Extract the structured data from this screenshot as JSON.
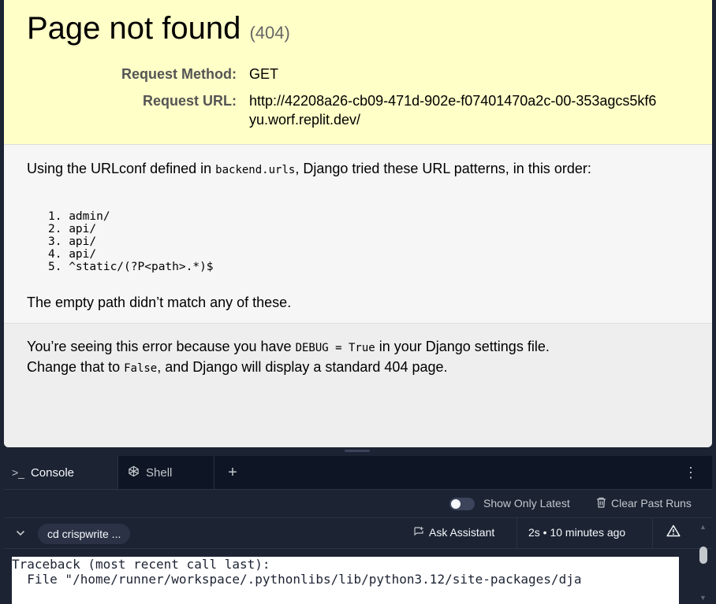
{
  "page": {
    "title": "Page not found",
    "status_code": "(404)",
    "request_method_label": "Request Method:",
    "request_method": "GET",
    "request_url_label": "Request URL:",
    "request_url": "http://42208a26-cb09-471d-902e-f07401470a2c-00-353agcs5kf6yu.worf.replit.dev/",
    "urlconf_intro_1": "Using the URLconf defined in ",
    "urlconf_module": "backend.urls",
    "urlconf_intro_2": ", Django tried these URL patterns, in this order:",
    "patterns": [
      "admin/",
      "api/",
      "api/",
      "api/",
      "^static/(?P<path>.*)$"
    ],
    "no_match": "The empty path didn’t match any of these.",
    "debug_1": "You’re seeing this error because you have ",
    "debug_code": "DEBUG = True",
    "debug_2": " in your Django settings file.",
    "debug_3": "Change that to ",
    "debug_false": "False",
    "debug_4": ", and Django will display a standard 404 page."
  },
  "console": {
    "tabs": [
      {
        "label": "Console",
        "icon": "terminal-prompt-icon"
      },
      {
        "label": "Shell",
        "icon": "shell-icon"
      }
    ],
    "add_tab": "+",
    "show_only_latest": "Show Only Latest",
    "clear_past_runs": "Clear Past Runs",
    "run_command": "cd crispwrite ...",
    "ask_assistant": "Ask Assistant",
    "timing": "2s • 10 minutes ago",
    "output_lines": [
      "Traceback (most recent call last):",
      "  File \"/home/runner/workspace/.pythonlibs/lib/python3.12/site-packages/dja"
    ]
  },
  "colors": {
    "summary_bg": "#ffffc8",
    "panel_bg": "#1c2333",
    "tabbar_bg": "#0e1525"
  }
}
